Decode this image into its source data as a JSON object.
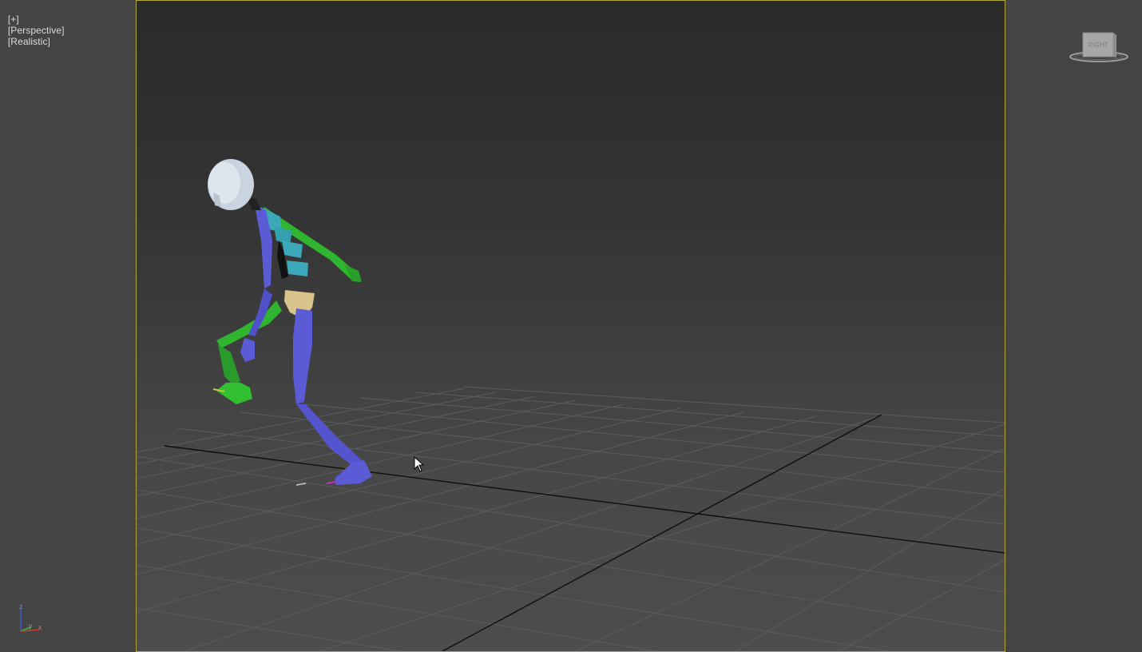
{
  "viewport": {
    "label_plus": "[+]",
    "label_view": "[Perspective]",
    "label_shading": "[Realistic]"
  },
  "viewcube": {
    "face_label": "RIGHT",
    "icon": "viewcube-icon"
  },
  "axis_tripod": {
    "z_label": "z",
    "y_label": "y",
    "x_label": "x"
  },
  "colors": {
    "frame_border": "#b5a83a",
    "biped_blue": "#5b5bd6",
    "biped_green": "#2fb52f",
    "biped_cyan": "#3aa8b8",
    "pelvis": "#d8c48a",
    "head": "#c9d4e0",
    "grid": "#5a5a5a",
    "grid_axis": "#111111"
  }
}
